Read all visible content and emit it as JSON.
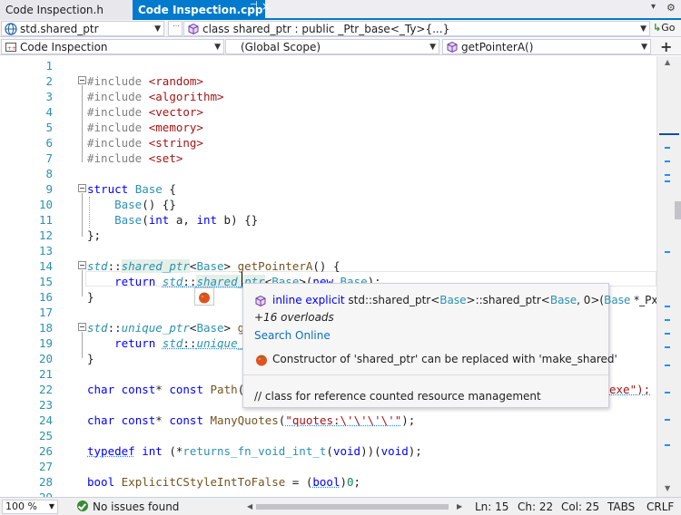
{
  "tabs": {
    "inactive_label": "Code Inspection.h",
    "active_label": "Code Inspection.cpp",
    "pin_glyph": "⊣",
    "close_glyph": "×",
    "menu_glyph": "▾",
    "settings_glyph": "⚙"
  },
  "nav1": {
    "project": "std.shared_ptr",
    "class_scope": "class shared_ptr : public _Ptr_base<_Ty>{...}",
    "go_label": "Go"
  },
  "nav2": {
    "file": "Code Inspection",
    "scope": "(Global Scope)",
    "member": "getPointerA()"
  },
  "line_numbers": [
    "1",
    "2",
    "3",
    "4",
    "5",
    "6",
    "7",
    "8",
    "9",
    "10",
    "11",
    "12",
    "13",
    "14",
    "15",
    "16",
    "17",
    "18",
    "19",
    "20",
    "21",
    "22",
    "23",
    "24",
    "25",
    "26",
    "27",
    "28",
    "29"
  ],
  "code": {
    "l2": {
      "d": "#include",
      "f": "<random>"
    },
    "l3": {
      "d": "#include",
      "f": "<algorithm>"
    },
    "l4": {
      "d": "#include",
      "f": "<vector>"
    },
    "l5": {
      "d": "#include",
      "f": "<memory>"
    },
    "l6": {
      "d": "#include",
      "f": "<string>"
    },
    "l7": {
      "d": "#include",
      "f": "<set>"
    },
    "l9": {
      "kw": "struct",
      "name": "Base",
      "brace": "{"
    },
    "l10": {
      "name": "Base",
      "rest": "() {}"
    },
    "l11": {
      "name": "Base",
      "p1": "(",
      "t1": "int",
      "a": " a, ",
      "t2": "int",
      "b": " b) {}"
    },
    "l12": {
      "text": "};"
    },
    "l14": {
      "ns": "std",
      "sep": "::",
      "tp": "shared_ptr",
      "lt": "<",
      "arg": "Base",
      "gt": "> ",
      "fn": "getPointerA",
      "rest": "() {"
    },
    "l15": {
      "kw": "return",
      "ns": "std",
      "sep": "::",
      "t1": "shared_",
      "t2": "p",
      "t3": "tr",
      "lt": "<",
      "arg": "Base",
      "gt": ">(",
      "nw": "new",
      "sp": " ",
      "base": "Base",
      "end": ");"
    },
    "l16": {
      "text": "}"
    },
    "l18": {
      "ns": "std",
      "sep": "::",
      "tp": "unique_ptr",
      "lt": "<",
      "arg": "Base",
      "gt": "> ",
      "fn": "g"
    },
    "l19": {
      "kw": "return",
      "ns": "std",
      "sep": "::",
      "tp": "unique_"
    },
    "l20": {
      "text": "}"
    },
    "l22": {
      "k1": "char",
      "c1": " ",
      "k2": "const",
      "s": "* ",
      "k3": "const",
      "sp": " ",
      "fn": "Path",
      "p": "(",
      "tail": "exe\");"
    },
    "l24": {
      "k1": "char",
      "c1": " ",
      "k2": "const",
      "s": "* ",
      "k3": "const",
      "sp": " ",
      "fn": "ManyQuotes",
      "p": "(",
      "str": "\"quotes:\\'\\'\\'\\'\"",
      "end": ");"
    },
    "l26": {
      "kw": "typedef",
      "sp": " ",
      "t": "int",
      "a": " (*",
      "ty": "returns_fn_void_int_t",
      "b": "(",
      "v1": "void",
      "c": "))(",
      "v2": "void",
      "d": ");"
    },
    "l28": {
      "k": "bool",
      "sp": " ",
      "fn": "ExplicitCStyleIntToFalse",
      "eq": " = (",
      "k2": "bool",
      "cl": ")",
      "n": "0",
      "sc": ";"
    }
  },
  "quickinfo": {
    "sig_kw": "inline explicit",
    "sig_ns": " std::",
    "sig_t1": "shared_ptr",
    "sig_lt": "<",
    "sig_arg": "Base",
    "sig_mid": ">::shared_ptr<",
    "sig_arg2": "Base",
    "sig_zero": ", 0>(",
    "sig_param": "Base",
    "sig_tail": " *_Px)",
    "overloads": "+16 overloads",
    "search": "Search Online",
    "fix": "Constructor of 'shared_ptr' can be replaced with 'make_shared'",
    "doc": "// class for reference counted resource management"
  },
  "status": {
    "zoom": "100 %",
    "issues": "No issues found",
    "line": "Ln: 15",
    "char": "Ch: 22",
    "col": "Col: 25",
    "tabs": "TABS",
    "eol": "CRLF"
  },
  "colors": {
    "accent": "#007acc",
    "keyword": "#0000ff",
    "type": "#2b91af",
    "string": "#a31515",
    "ok": "#388a34"
  }
}
